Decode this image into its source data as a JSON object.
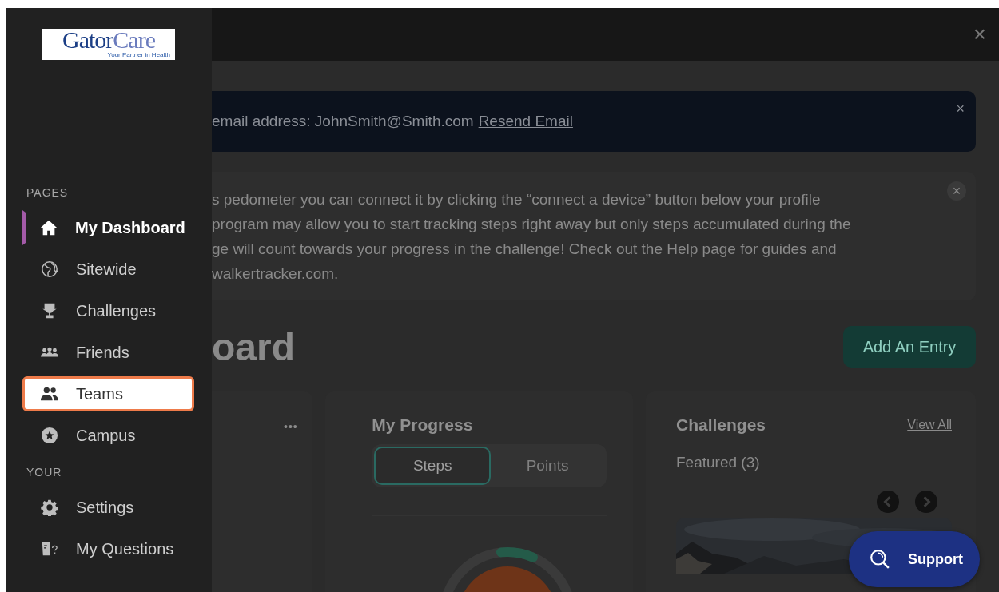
{
  "logo": {
    "name_parts": [
      "Gator",
      "Care"
    ],
    "tagline": "Your Partner in Health"
  },
  "sidebar": {
    "sections": [
      {
        "title": "PAGES",
        "items": [
          {
            "label": "My Dashboard",
            "kind": "home",
            "selected": true,
            "highlighted": false
          },
          {
            "label": "Sitewide",
            "kind": "globe",
            "selected": false,
            "highlighted": false
          },
          {
            "label": "Challenges",
            "kind": "trophy",
            "selected": false,
            "highlighted": false
          },
          {
            "label": "Friends",
            "kind": "group",
            "selected": false,
            "highlighted": false
          },
          {
            "label": "Teams",
            "kind": "pair",
            "selected": false,
            "highlighted": true
          },
          {
            "label": "Campus",
            "kind": "star",
            "selected": false,
            "highlighted": false
          }
        ]
      },
      {
        "title": "YOUR",
        "items": [
          {
            "label": "Settings",
            "kind": "gear",
            "selected": false,
            "highlighted": false
          },
          {
            "label": "My Questions",
            "kind": "question",
            "selected": false,
            "highlighted": false
          }
        ]
      }
    ]
  },
  "top_bar": {
    "close": "×"
  },
  "email_banner": {
    "text": "email address: JohnSmith@Smith.com",
    "link": "Resend Email",
    "close": "×"
  },
  "info_box": {
    "lines": [
      "s pedometer you can connect it by clicking the “connect a device” button below your profile",
      "program may allow you to start tracking steps right away but only steps accumulated during the",
      "ge will count towards your progress in the challenge!  Check out the Help page for guides and",
      "walkertracker.com."
    ],
    "close": "×"
  },
  "heading": "oard",
  "add_button": "Add An Entry",
  "left_card": {
    "menu": "•••"
  },
  "progress_card": {
    "title": "My Progress",
    "tabs": [
      {
        "label": "Steps",
        "selected": true
      },
      {
        "label": "Points",
        "selected": false
      }
    ]
  },
  "challenges_card": {
    "title": "Challenges",
    "link": "View All",
    "featured": "Featured (3)"
  },
  "support_button": "Support"
}
